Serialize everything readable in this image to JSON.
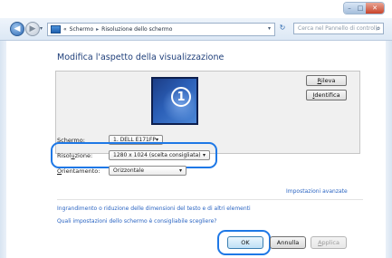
{
  "window": {
    "caption_minimize": "–",
    "caption_maximize": "□",
    "caption_close": "✕"
  },
  "navbar": {
    "back_glyph": "◀",
    "forward_glyph": "▶",
    "history_glyph": "▾",
    "address_prefix": "«",
    "breadcrumb_1": "Schermo",
    "breadcrumb_sep": "▸",
    "breadcrumb_2": "Risoluzione dello schermo",
    "address_dropdown": "▾",
    "refresh_glyph": "↻",
    "search_placeholder": "Cerca nel Pannello di controllo",
    "search_glyph": "⌕"
  },
  "page": {
    "heading": "Modifica l'aspetto della visualizzazione",
    "monitor_number": "1",
    "detect_label_first": "R",
    "detect_label_rest": "ileva",
    "identify_label_first": "I",
    "identify_label_rest": "dentifica"
  },
  "settings": {
    "screen_label_first": "S",
    "screen_label_rest": "chermo:",
    "screen_value": "1. DELL E171FP",
    "resolution_label_pre": "Risol",
    "resolution_label_u": "u",
    "resolution_label_rest": "zione:",
    "resolution_value": "1280 x 1024 (scelta consigliata)",
    "orientation_label_first": "O",
    "orientation_label_rest": "rientamento:",
    "orientation_value": "Orizzontale",
    "dropdown_glyph": "▾"
  },
  "links": {
    "advanced": "Impostazioni avanzate",
    "text_size": "Ingrandimento o riduzione delle dimensioni del testo e di altri elementi",
    "which_settings": "Quali impostazioni dello schermo è consigliabile scegliere?"
  },
  "buttons": {
    "ok": "OK",
    "cancel": "Annulla",
    "apply_first": "A",
    "apply_rest": "pplica"
  },
  "colors": {
    "highlight": "#1e78e6",
    "link": "#2a64c2",
    "heading": "#1f3f7a"
  }
}
